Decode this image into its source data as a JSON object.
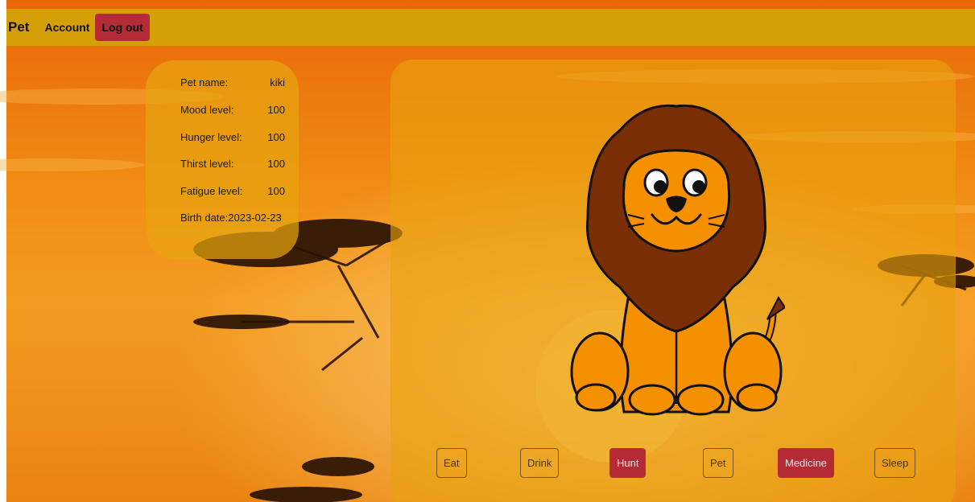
{
  "navbar": {
    "brand": "Pet",
    "account_label": "Account",
    "logout_label": "Log out"
  },
  "pet": {
    "labels": {
      "name": "Pet name:",
      "mood": "Mood level:",
      "hunger": "Hunger level:",
      "thirst": "Thirst level:",
      "fatigue": "Fatigue level:",
      "birth": "Birth date:"
    },
    "name": "kiki",
    "mood": "100",
    "hunger": "100",
    "thirst": "100",
    "fatigue": "100",
    "birth_date": "2023-02-23"
  },
  "actions": {
    "eat": "Eat",
    "drink": "Drink",
    "hunt": "Hunt",
    "pet": "Pet",
    "medicine": "Medicine",
    "sleep": "Sleep"
  },
  "colors": {
    "navbar": "#d59f07",
    "accent_red": "#b42a35",
    "panel": "#e6a50f",
    "lion_body": "#f59000",
    "lion_mane": "#7a2e05"
  }
}
